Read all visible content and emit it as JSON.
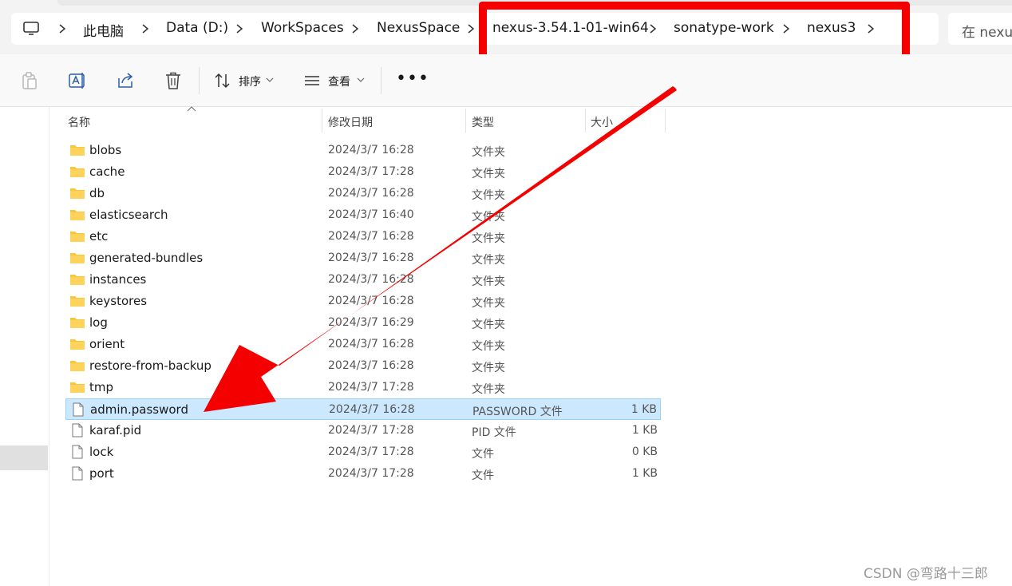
{
  "breadcrumb": {
    "items": [
      "此电脑",
      "Data (D:)",
      "WorkSpaces",
      "NexusSpace",
      "nexus-3.54.1-01-win64",
      "sonatype-work",
      "nexus3"
    ]
  },
  "search": {
    "placeholder": "在 nexus"
  },
  "toolbar": {
    "sort_label": "排序",
    "view_label": "查看"
  },
  "columns": {
    "name": "名称",
    "modified": "修改日期",
    "type": "类型",
    "size": "大小"
  },
  "files": [
    {
      "name": "blobs",
      "modified": "2024/3/7 16:28",
      "type": "文件夹",
      "size": "",
      "kind": "folder"
    },
    {
      "name": "cache",
      "modified": "2024/3/7 17:28",
      "type": "文件夹",
      "size": "",
      "kind": "folder"
    },
    {
      "name": "db",
      "modified": "2024/3/7 16:28",
      "type": "文件夹",
      "size": "",
      "kind": "folder"
    },
    {
      "name": "elasticsearch",
      "modified": "2024/3/7 16:40",
      "type": "文件夹",
      "size": "",
      "kind": "folder"
    },
    {
      "name": "etc",
      "modified": "2024/3/7 16:28",
      "type": "文件夹",
      "size": "",
      "kind": "folder"
    },
    {
      "name": "generated-bundles",
      "modified": "2024/3/7 16:28",
      "type": "文件夹",
      "size": "",
      "kind": "folder"
    },
    {
      "name": "instances",
      "modified": "2024/3/7 16:28",
      "type": "文件夹",
      "size": "",
      "kind": "folder"
    },
    {
      "name": "keystores",
      "modified": "2024/3/7 16:28",
      "type": "文件夹",
      "size": "",
      "kind": "folder"
    },
    {
      "name": "log",
      "modified": "2024/3/7 16:29",
      "type": "文件夹",
      "size": "",
      "kind": "folder"
    },
    {
      "name": "orient",
      "modified": "2024/3/7 16:28",
      "type": "文件夹",
      "size": "",
      "kind": "folder"
    },
    {
      "name": "restore-from-backup",
      "modified": "2024/3/7 16:28",
      "type": "文件夹",
      "size": "",
      "kind": "folder"
    },
    {
      "name": "tmp",
      "modified": "2024/3/7 17:28",
      "type": "文件夹",
      "size": "",
      "kind": "folder"
    },
    {
      "name": "admin.password",
      "modified": "2024/3/7 16:28",
      "type": "PASSWORD 文件",
      "size": "1 KB",
      "kind": "file",
      "selected": true
    },
    {
      "name": "karaf.pid",
      "modified": "2024/3/7 17:28",
      "type": "PID 文件",
      "size": "1 KB",
      "kind": "file"
    },
    {
      "name": "lock",
      "modified": "2024/3/7 17:28",
      "type": "文件",
      "size": "0 KB",
      "kind": "file"
    },
    {
      "name": "port",
      "modified": "2024/3/7 17:28",
      "type": "文件",
      "size": "1 KB",
      "kind": "file"
    }
  ],
  "watermark": "CSDN @弯路十三郎",
  "colors": {
    "annotation_red": "#f40000",
    "selection_bg": "#cce8ff",
    "folder_yellow": "#f8c63a"
  }
}
